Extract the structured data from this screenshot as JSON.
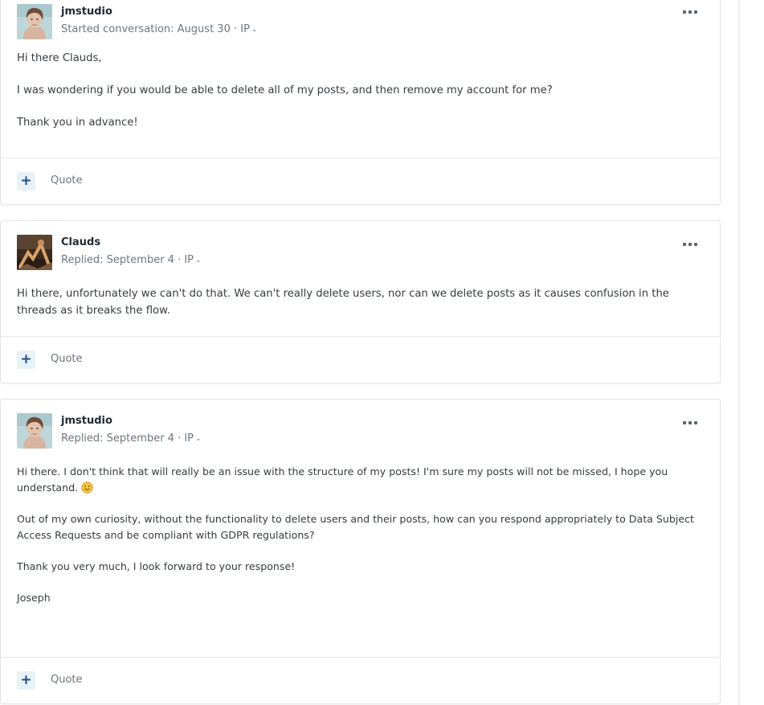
{
  "posts": [
    {
      "author": "jmstudio",
      "meta_prefix": "Started conversation: August 30",
      "meta_ip": " · IP",
      "avatar": "woman-portrait-avatar",
      "paragraphs": [
        "Hi there Clauds,",
        "I was wondering if you would be able to delete all of my posts, and then remove my account for me?",
        "Thank you in advance!"
      ],
      "add_label": "+",
      "quote_label": "Quote"
    },
    {
      "author": "Clauds",
      "meta_prefix": "Replied: September 4",
      "meta_ip": " · IP",
      "avatar": "figure-photo-avatar",
      "paragraphs": [
        "Hi there, unfortunately we can't do that. We can't really delete users, nor can we delete posts as it causes confusion in the threads as it breaks the flow."
      ],
      "add_label": "+",
      "quote_label": "Quote"
    },
    {
      "author": "jmstudio",
      "meta_prefix": "Replied: September 4",
      "meta_ip": " · IP",
      "avatar": "woman-portrait-avatar",
      "paragraphs": [
        "Hi there. I don't think that will really be an issue with the structure of my posts! I'm sure my posts will not be missed, I hope you understand.",
        "Out of my own curiosity, without the functionality to delete users and their posts, how can you respond appropriately to Data Subject Access Requests and be compliant with GDPR regulations?",
        "Thank you very much, I look forward to your response!",
        "Joseph"
      ],
      "emoji_after_paragraph_0": "smile-emoji",
      "add_label": "+",
      "quote_label": "Quote"
    }
  ],
  "icons": {
    "more": "more-options-icon",
    "chevron": "chevron-down-icon",
    "chevron_glyph": "⌄"
  },
  "colors": {
    "accent": "#1d4f84",
    "plus_bg": "#e9f1f8",
    "muted_text": "#6a7680",
    "border": "#e2e5e9"
  }
}
